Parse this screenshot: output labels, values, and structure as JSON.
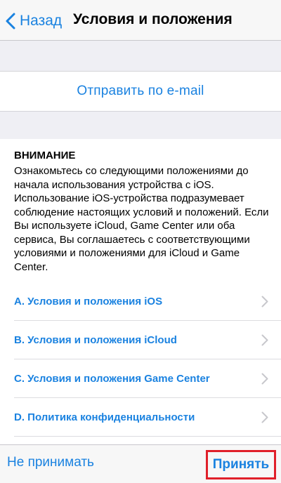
{
  "nav": {
    "back_label": "Назад",
    "title": "Условия и положения"
  },
  "email_action": {
    "label": "Отправить по e-mail"
  },
  "notice": {
    "heading": "ВНИМАНИЕ",
    "body": "Ознакомьтесь со следующими положениями до начала использования устройства с iOS. Использование iOS-устройства подразумевает соблюдение настоящих условий и положений. Если Вы используете iCloud, Game Center или оба сервиса, Вы соглашаетесь с соответствующими условиями и положениями для iCloud и Game Center."
  },
  "terms_list": {
    "items": [
      {
        "label": "A. Условия и положения iOS"
      },
      {
        "label": "B. Условия и положения iCloud"
      },
      {
        "label": "C. Условия и положения Game Center"
      },
      {
        "label": "D. Политика конфиденциальности"
      }
    ]
  },
  "toolbar": {
    "decline_label": "Не принимать",
    "accept_label": "Принять"
  },
  "colors": {
    "accent": "#1a82e0",
    "highlight": "#e0202a",
    "background_gray": "#efeff4"
  },
  "icons": {
    "back": "chevron-left-icon",
    "row_disclosure": "chevron-right-icon"
  }
}
